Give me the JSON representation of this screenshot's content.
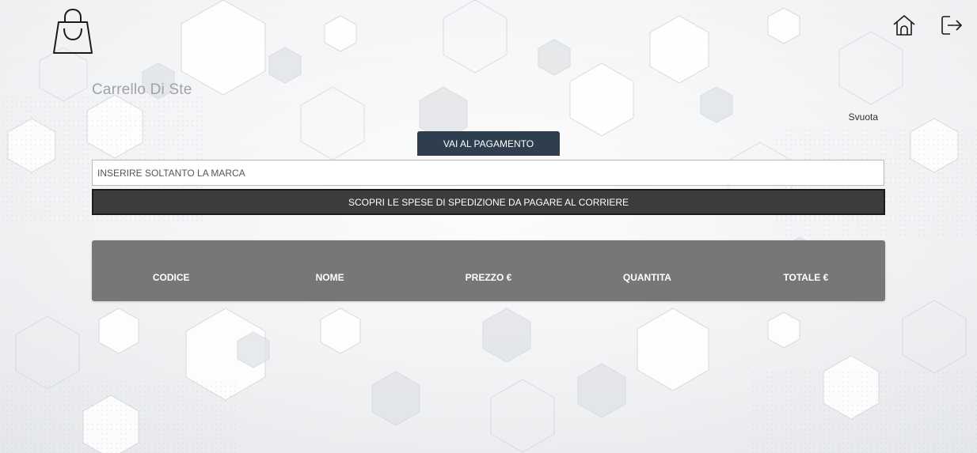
{
  "header": {
    "logo_icon": "shopping-bag-icon",
    "home_icon": "home-icon",
    "logout_icon": "logout-icon"
  },
  "page": {
    "title": "Carrello Di Ste",
    "empty_label": "Svuota"
  },
  "actions": {
    "pay_label": "VAI AL PAGAMENTO",
    "brand_placeholder": "INSERIRE SOLTANTO LA MARCA",
    "brand_value": "",
    "shipping_label": "SCOPRI LE SPESE DI SPEDIZIONE DA PAGARE AL CORRIERE"
  },
  "table": {
    "columns": [
      "CODICE",
      "NOME",
      "PREZZO €",
      "QUANTITA",
      "TOTALE €"
    ],
    "rows": []
  },
  "colors": {
    "pay_button": "#2f3e4e",
    "shipping_button": "#3c3c3c",
    "table_header": "#777777",
    "title_text": "#9ea3a8"
  }
}
